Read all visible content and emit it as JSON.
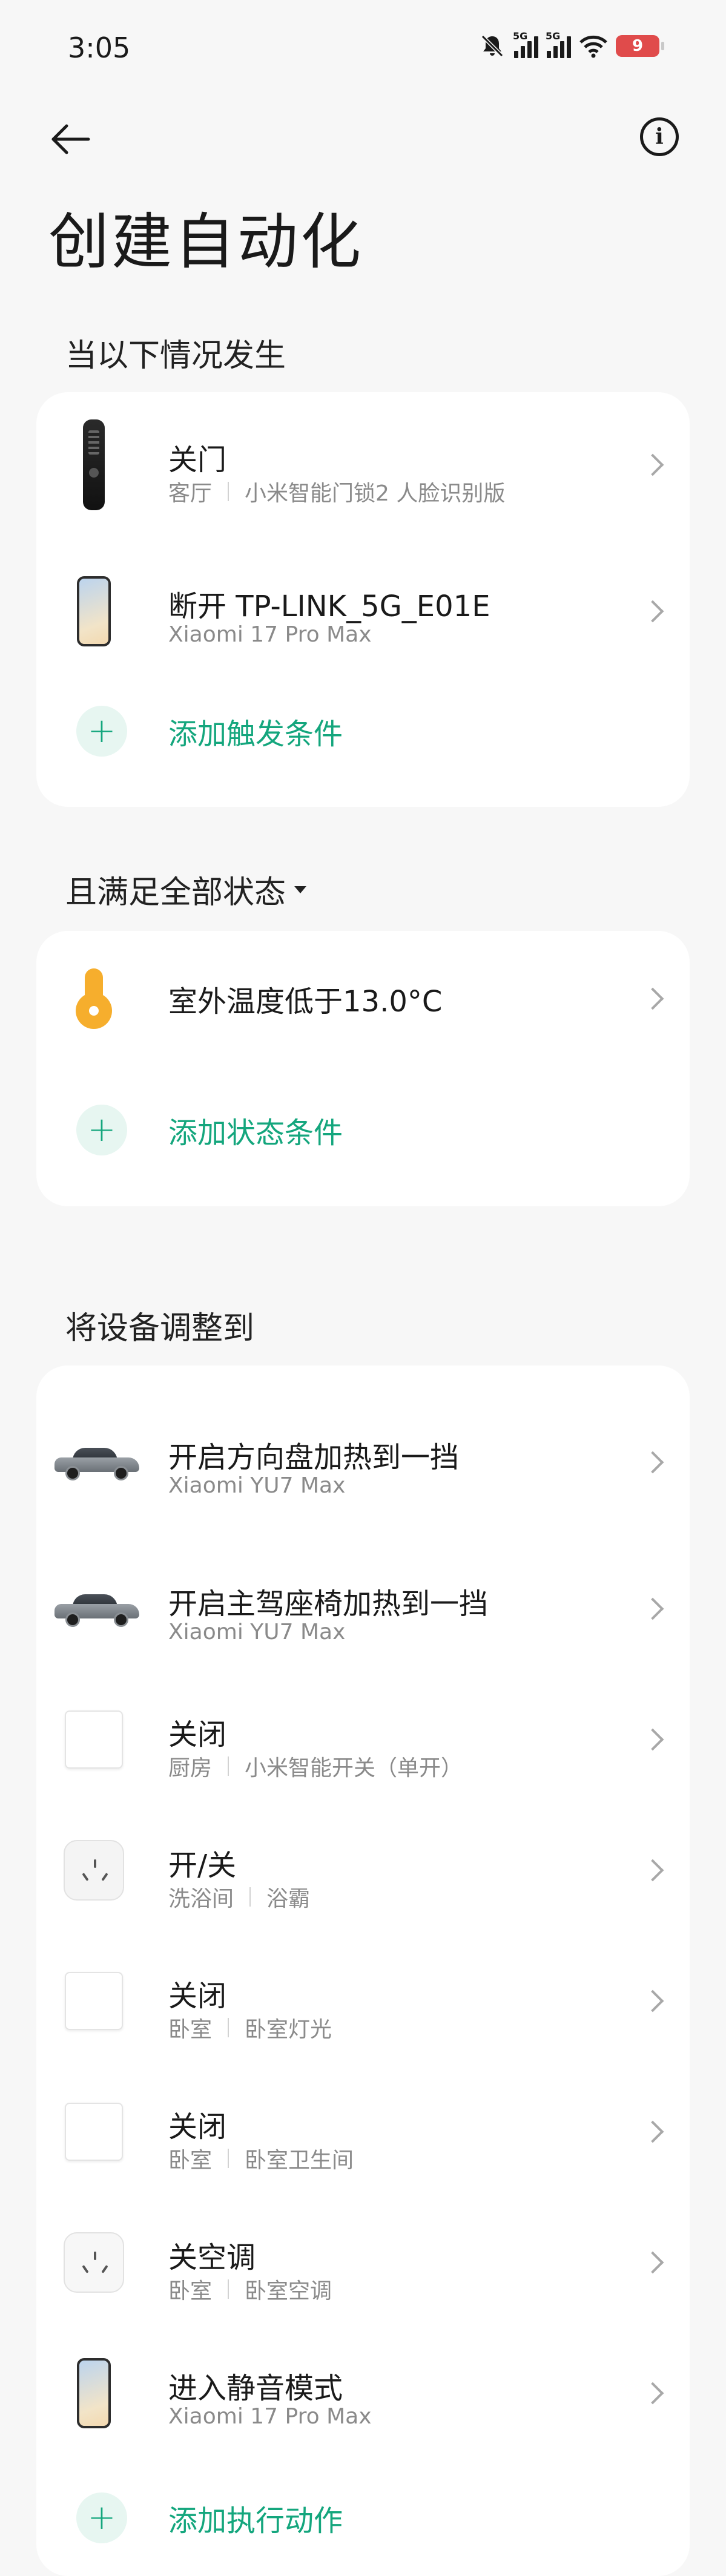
{
  "status_bar": {
    "time": "3:05",
    "network_tag_1": "5G",
    "network_tag_2": "5G",
    "battery": "9",
    "icons": [
      "mute-bell-icon",
      "signal-icon",
      "signal-icon",
      "wifi-icon",
      "battery-icon"
    ]
  },
  "nav": {
    "back_icon": "back-arrow-icon",
    "info_icon": "info-icon",
    "info_glyph": "i"
  },
  "page": {
    "title": "创建自动化"
  },
  "triggers": {
    "heading": "当以下情况发生",
    "items": [
      {
        "title": "关门",
        "room": "客厅",
        "device": "小米智能门锁2 人脸识别版",
        "icon": "door-lock"
      },
      {
        "title": "断开 TP-LINK_5G_E01E",
        "device": "Xiaomi 17 Pro Max",
        "icon": "phone"
      }
    ],
    "add_label": "添加触发条件"
  },
  "conditions": {
    "heading": "且满足全部状态",
    "items": [
      {
        "title": "室外温度低于13.0°C",
        "icon": "thermometer"
      }
    ],
    "add_label": "添加状态条件"
  },
  "actions": {
    "heading": "将设备调整到",
    "items": [
      {
        "title": "开启方向盘加热到一挡",
        "device": "Xiaomi YU7 Max",
        "icon": "car"
      },
      {
        "title": "开启主驾座椅加热到一挡",
        "device": "Xiaomi YU7 Max",
        "icon": "car"
      },
      {
        "title": "关闭",
        "room": "厨房",
        "device": "小米智能开关（单开）",
        "icon": "wall-switch"
      },
      {
        "title": "开/关",
        "room": "洗浴间",
        "device": "浴霸",
        "icon": "smart-plug"
      },
      {
        "title": "关闭",
        "room": "卧室",
        "device": "卧室灯光",
        "icon": "wall-switch"
      },
      {
        "title": "关闭",
        "room": "卧室",
        "device": "卧室卫生间",
        "icon": "wall-switch"
      },
      {
        "title": "关空调",
        "room": "卧室",
        "device": "卧室空调",
        "icon": "ac-plug"
      },
      {
        "title": "进入静音模式",
        "device": "Xiaomi 17 Pro Max",
        "icon": "phone"
      }
    ],
    "add_label": "添加执行动作"
  },
  "colors": {
    "accent": "#14a67d",
    "accent_bg": "#e7f6f1",
    "battery_low": "#e04b4b",
    "thermo": "#f6ae2d"
  }
}
